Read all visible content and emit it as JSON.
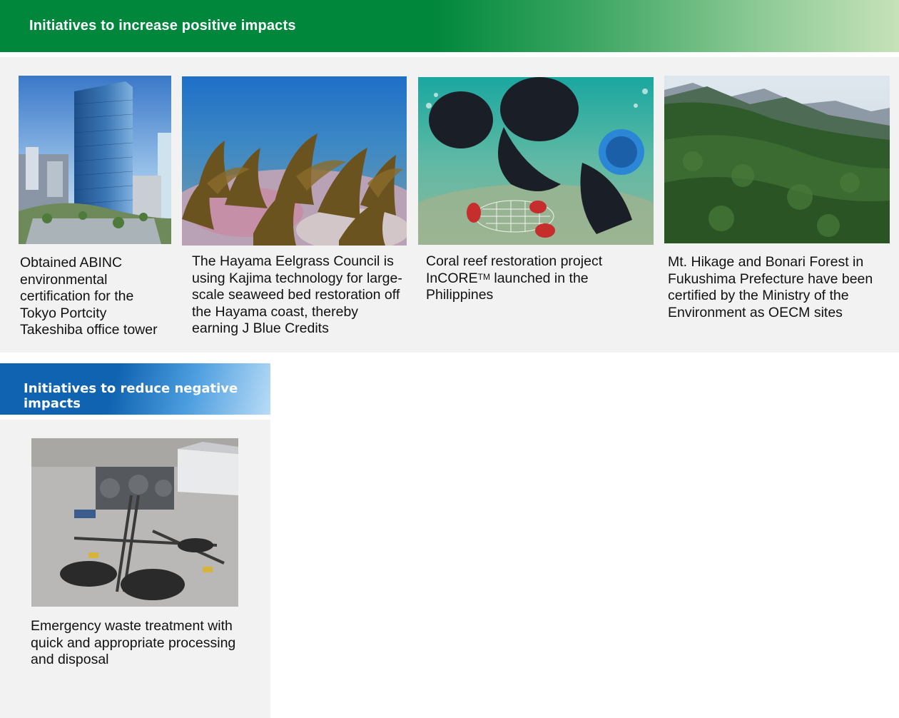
{
  "positive": {
    "banner_title": "Initiatives to increase positive impacts",
    "items": [
      {
        "photo": "office-tower-photo",
        "caption": "Obtained ABINC environmental certification for the Tokyo Portcity Takeshiba office tower"
      },
      {
        "photo": "seaweed-bed-photo",
        "caption": "The Hayama Eelgrass Council is using Kajima technology for large-scale seaweed bed restoration off the Hayama coast, thereby earning J Blue Credits"
      },
      {
        "photo": "coral-divers-photo",
        "caption_pre": "Coral reef restoration project InCORE",
        "caption_sup": "TM",
        "caption_post": " launched in the Philippines"
      },
      {
        "photo": "forest-mountains-photo",
        "caption": "Mt. Hikage and Bonari Forest in Fukushima Prefecture have been certified by the Ministry of the Environment as OECM sites"
      }
    ]
  },
  "negative": {
    "banner_title": "Initiatives to reduce negative impacts",
    "items": [
      {
        "photo": "waste-treatment-plant-photo",
        "caption": "Emergency waste treatment with quick and appropriate processing and disposal"
      }
    ]
  },
  "colors": {
    "green_banner": "#00873c",
    "blue_banner": "#0f63b0",
    "panel_bg": "#f2f2f2"
  }
}
